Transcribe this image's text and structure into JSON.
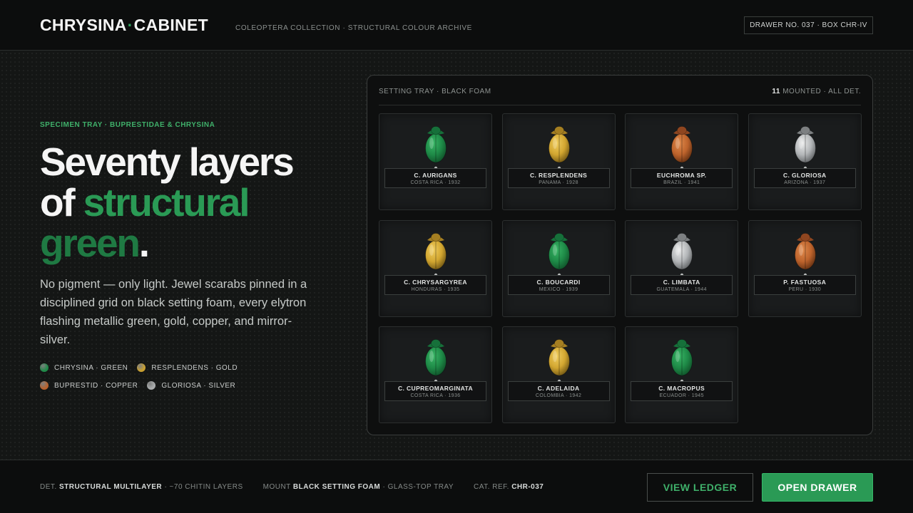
{
  "header": {
    "logo_left": "CHRYSINA",
    "logo_dot": "·",
    "logo_right": "CABINET",
    "subtitle": "COLEOPTERA COLLECTION · STRUCTURAL COLOUR ARCHIVE",
    "drawer_badge": "DRAWER NO. 037 · BOX CHR-IV"
  },
  "hero": {
    "eyebrow": "SPECIMEN TRAY · BUPRESTIDAE & CHRYSINA",
    "headline_1": "Seventy layers",
    "headline_2a": "of ",
    "headline_2b": "structural",
    "headline_3a": "green",
    "headline_3b": ".",
    "body": "No pigment — only light. Jewel scarabs pinned in a disciplined grid on black setting foam, every elytron flashing metallic green, gold, copper, and mirror-silver."
  },
  "legend": [
    {
      "label": "CHRYSINA · GREEN",
      "color": "#1f8a48"
    },
    {
      "label": "RESPLENDENS · GOLD",
      "color": "#c9a030"
    },
    {
      "label": "BUPRESTID · COPPER",
      "color": "#b8612c"
    },
    {
      "label": "GLORIOSA · SILVER",
      "color": "#a9acad"
    }
  ],
  "tray": {
    "title": "SETTING TRAY · BLACK FOAM",
    "count": "11",
    "count_suffix": " MOUNTED · ALL DET."
  },
  "palette": {
    "green": {
      "body": "#1e8a47",
      "light": "#38b565",
      "dark": "#0f4f28",
      "head": "#16703a"
    },
    "gold": {
      "body": "#d2a630",
      "light": "#f0cd5e",
      "dark": "#6b5212",
      "head": "#a57f22"
    },
    "copper": {
      "body": "#bd632c",
      "light": "#e08a4c",
      "dark": "#5e2d10",
      "head": "#8f4620"
    },
    "silver": {
      "body": "#b3b6b8",
      "light": "#e9eaea",
      "dark": "#5d6062",
      "head": "#7d8082"
    }
  },
  "specimens": [
    {
      "name": "C. AURIGANS",
      "meta": "COSTA RICA · 1932",
      "color": "green"
    },
    {
      "name": "C. RESPLENDENS",
      "meta": "PANAMA · 1928",
      "color": "gold"
    },
    {
      "name": "EUCHROMA SP.",
      "meta": "BRAZIL · 1941",
      "color": "copper"
    },
    {
      "name": "C. GLORIOSA",
      "meta": "ARIZONA · 1937",
      "color": "silver"
    },
    {
      "name": "C. CHRYSARGYREA",
      "meta": "HONDURAS · 1935",
      "color": "gold"
    },
    {
      "name": "C. BOUCARDI",
      "meta": "MEXICO · 1939",
      "color": "green"
    },
    {
      "name": "C. LIMBATA",
      "meta": "GUATEMALA · 1944",
      "color": "silver"
    },
    {
      "name": "P. FASTUOSA",
      "meta": "PERU · 1930",
      "color": "copper"
    },
    {
      "name": "C. CUPREOMARGINATA",
      "meta": "COSTA RICA · 1936",
      "color": "green"
    },
    {
      "name": "C. ADELAIDA",
      "meta": "COLOMBIA · 1942",
      "color": "gold"
    },
    {
      "name": "C. MACROPUS",
      "meta": "ECUADOR · 1945",
      "color": "green"
    }
  ],
  "footer": {
    "det_key": "DET.",
    "det_value": "STRUCTURAL MULTILAYER",
    "det_extra": "· ~70 CHITIN LAYERS",
    "mount_key": "MOUNT",
    "mount_value": "BLACK SETTING FOAM",
    "mount_extra": "· GLASS-TOP TRAY",
    "cat_key": "CAT. REF.",
    "cat_value": "CHR-037",
    "ledger_button": "VIEW LEDGER",
    "open_button": "OPEN DRAWER"
  }
}
